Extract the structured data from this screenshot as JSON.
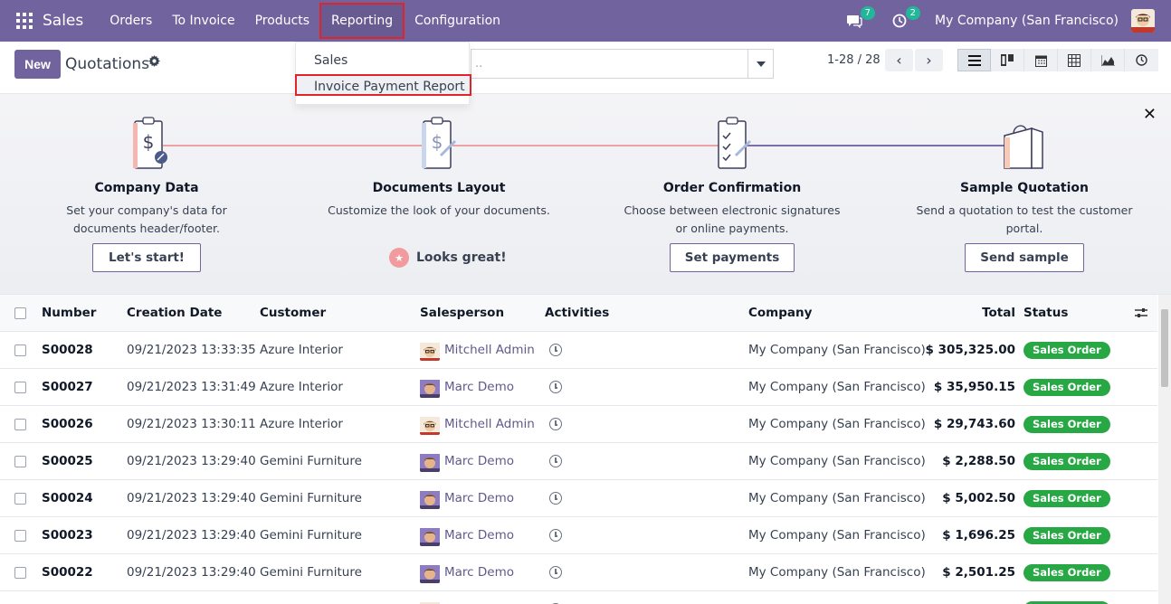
{
  "navbar": {
    "brand": "Sales",
    "menu": [
      "Orders",
      "To Invoice",
      "Products",
      "Reporting",
      "Configuration"
    ],
    "messages_count": "7",
    "activities_count": "2",
    "company": "My Company (San Francisco)"
  },
  "reporting_menu": {
    "items": [
      "Sales",
      "Invoice Payment Report"
    ]
  },
  "control": {
    "new_label": "New",
    "title": "Quotations",
    "search_placeholder": "..",
    "pager": "1-28 / 28"
  },
  "onboarding": {
    "steps": [
      {
        "title": "Company Data",
        "desc": "Set your company's data for documents header/footer.",
        "button": "Let's start!"
      },
      {
        "title": "Documents Layout",
        "desc": "Customize the look of your documents.",
        "done": "Looks great!"
      },
      {
        "title": "Order Confirmation",
        "desc": "Choose between electronic signatures or online payments.",
        "button": "Set payments"
      },
      {
        "title": "Sample Quotation",
        "desc": "Send a quotation to test the customer portal.",
        "button": "Send sample"
      }
    ]
  },
  "table": {
    "headers": [
      "Number",
      "Creation Date",
      "Customer",
      "Salesperson",
      "Activities",
      "Company",
      "Total",
      "Status"
    ],
    "rows": [
      {
        "number": "S00028",
        "date": "09/21/2023 13:33:35",
        "customer": "Azure Interior",
        "salesperson": "Mitchell Admin",
        "avatar": "admin",
        "company": "My Company (San Francisco)",
        "total": "$ 305,325.00",
        "status": "Sales Order"
      },
      {
        "number": "S00027",
        "date": "09/21/2023 13:31:49",
        "customer": "Azure Interior",
        "salesperson": "Marc Demo",
        "avatar": "demo",
        "company": "My Company (San Francisco)",
        "total": "$ 35,950.15",
        "status": "Sales Order"
      },
      {
        "number": "S00026",
        "date": "09/21/2023 13:30:11",
        "customer": "Azure Interior",
        "salesperson": "Mitchell Admin",
        "avatar": "admin",
        "company": "My Company (San Francisco)",
        "total": "$ 29,743.60",
        "status": "Sales Order"
      },
      {
        "number": "S00025",
        "date": "09/21/2023 13:29:40",
        "customer": "Gemini Furniture",
        "salesperson": "Marc Demo",
        "avatar": "demo",
        "company": "My Company (San Francisco)",
        "total": "$ 2,288.50",
        "status": "Sales Order"
      },
      {
        "number": "S00024",
        "date": "09/21/2023 13:29:40",
        "customer": "Gemini Furniture",
        "salesperson": "Marc Demo",
        "avatar": "demo",
        "company": "My Company (San Francisco)",
        "total": "$ 5,002.50",
        "status": "Sales Order"
      },
      {
        "number": "S00023",
        "date": "09/21/2023 13:29:40",
        "customer": "Gemini Furniture",
        "salesperson": "Marc Demo",
        "avatar": "demo",
        "company": "My Company (San Francisco)",
        "total": "$ 1,696.25",
        "status": "Sales Order"
      },
      {
        "number": "S00022",
        "date": "09/21/2023 13:29:40",
        "customer": "Gemini Furniture",
        "salesperson": "Marc Demo",
        "avatar": "demo",
        "company": "My Company (San Francisco)",
        "total": "$ 2,501.25",
        "status": "Sales Order"
      },
      {
        "number": "",
        "date": "",
        "customer": "",
        "salesperson": "",
        "avatar": "admin",
        "company": "",
        "total": "",
        "status": "Sales Order"
      }
    ]
  },
  "icons": {
    "apps": "apps-grid-icon",
    "messages": "chat-icon",
    "activities": "clock-icon",
    "settings": "gear-icon",
    "close": "close-icon"
  },
  "colors": {
    "brand": "#71639e",
    "status_green": "#28a745",
    "highlight": "#e0242b"
  }
}
